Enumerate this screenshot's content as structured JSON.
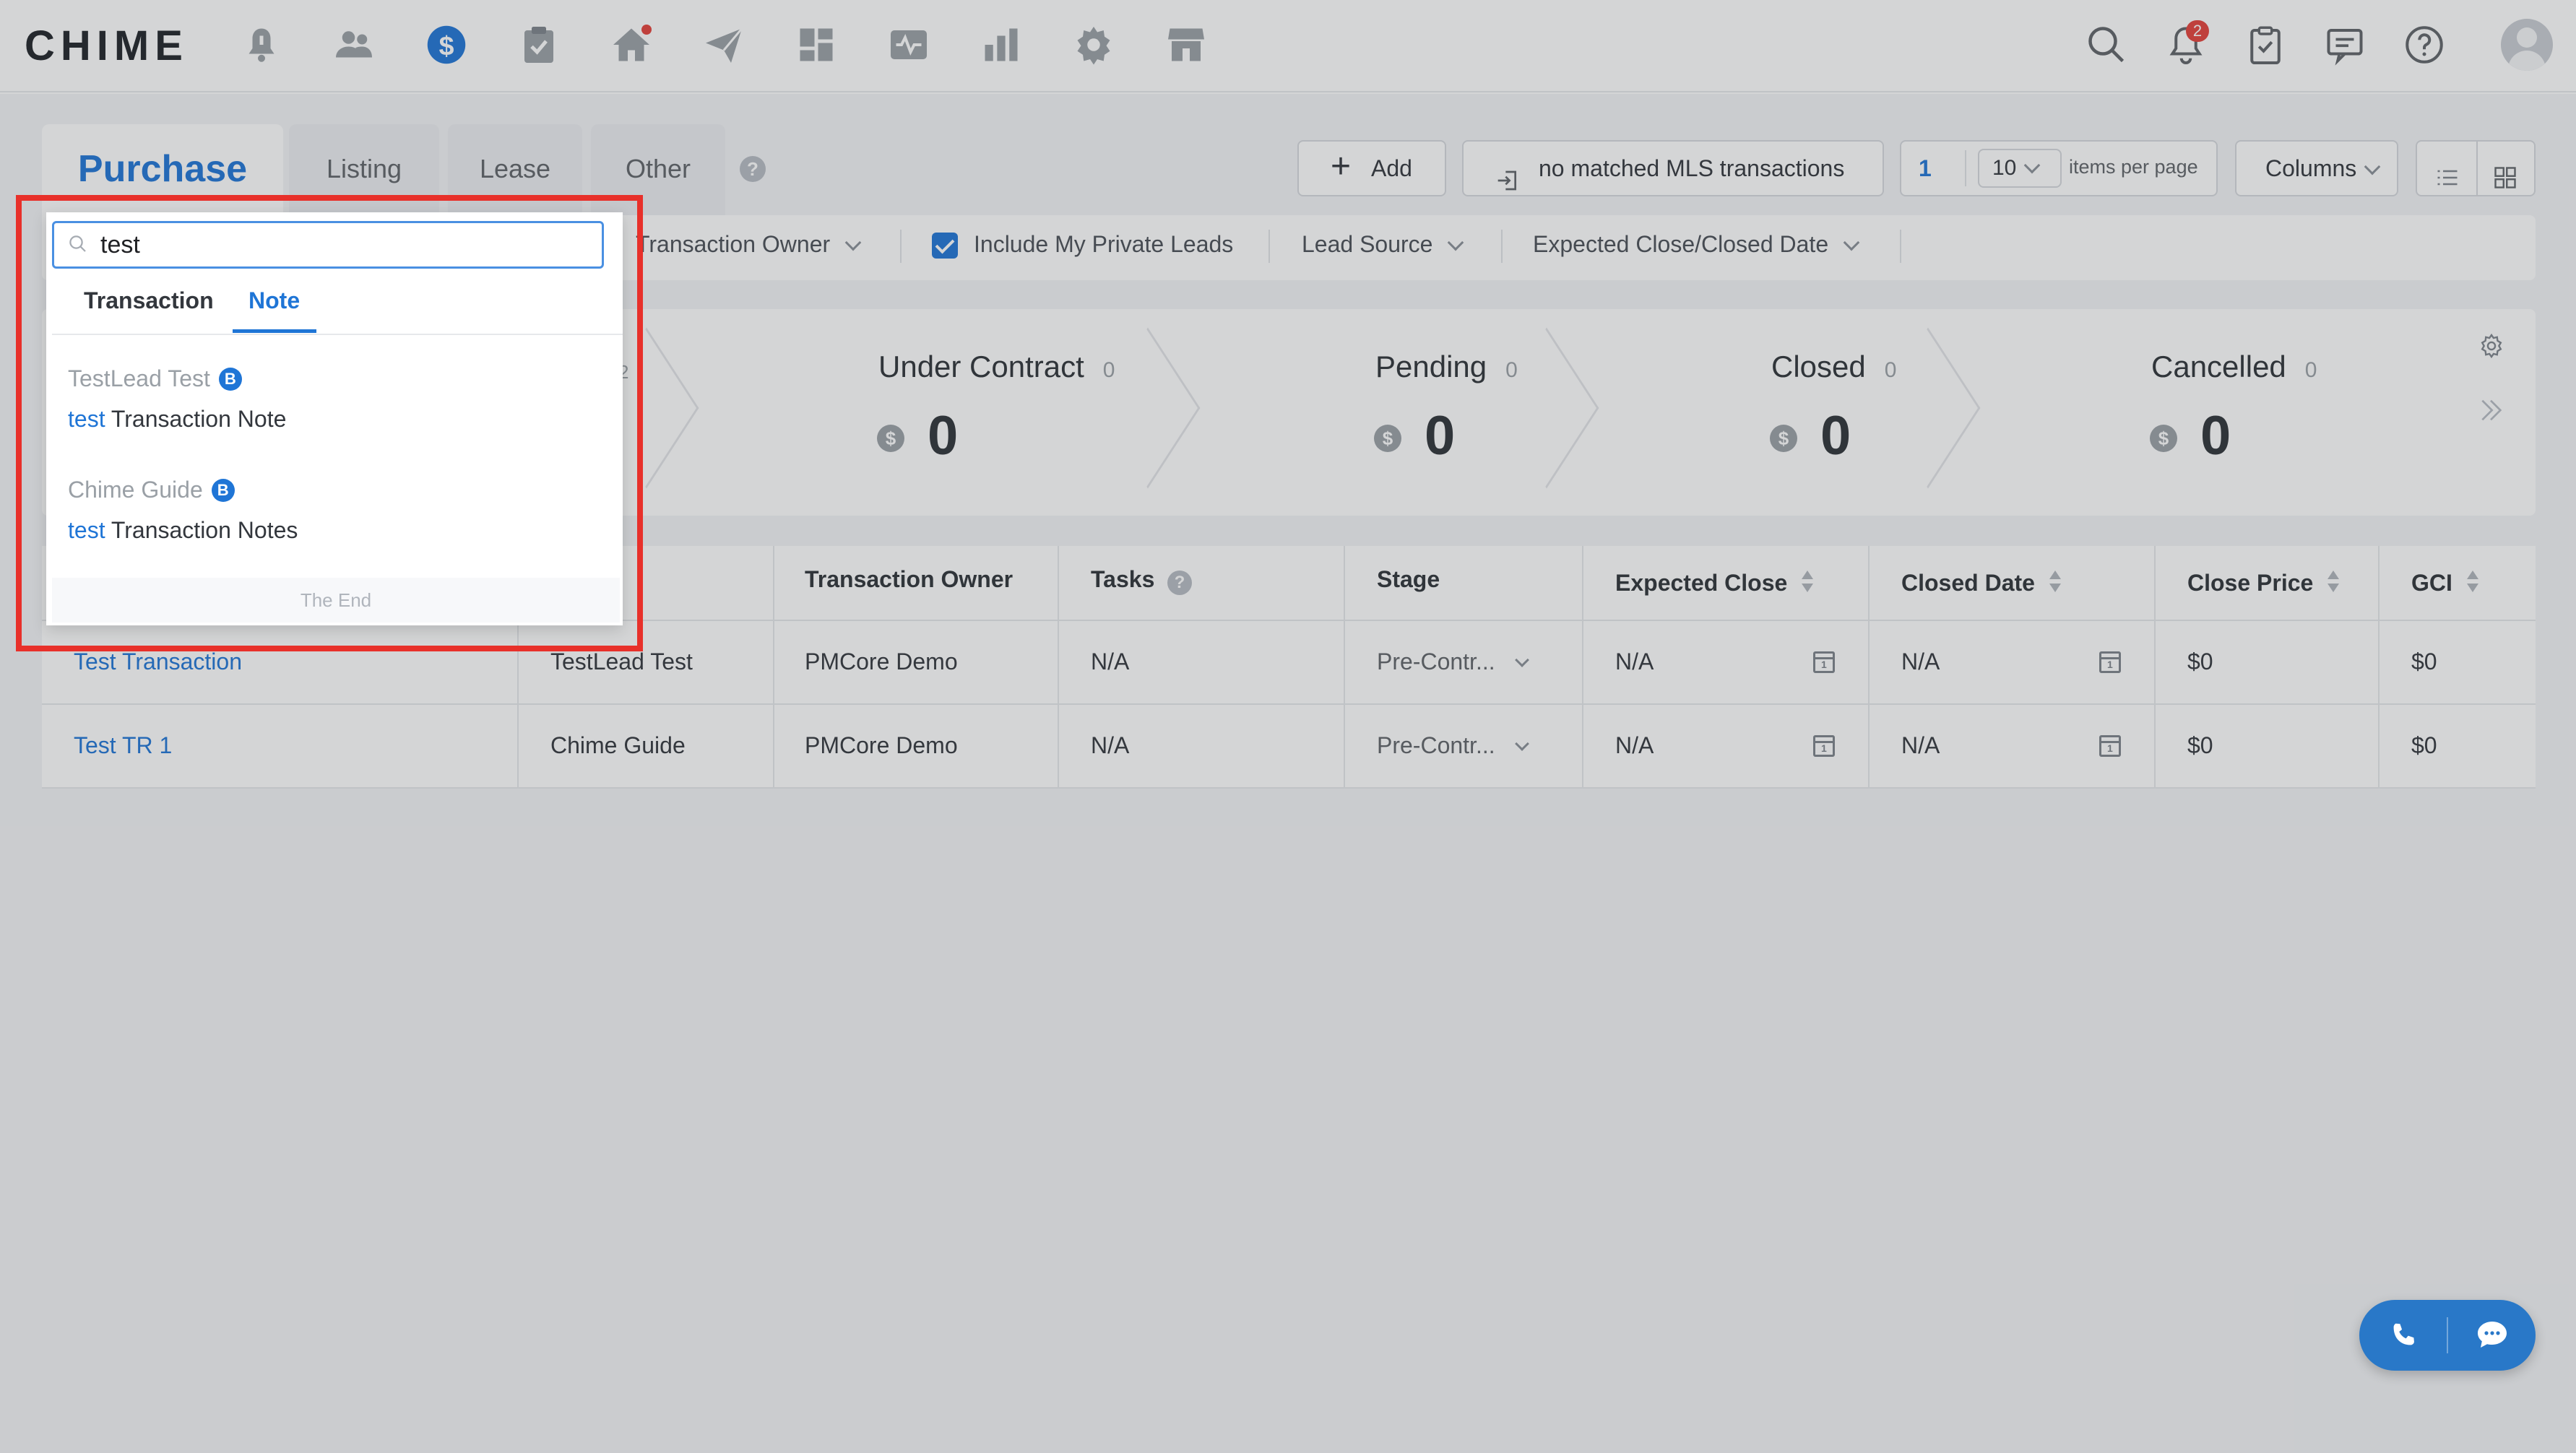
{
  "app": {
    "logo": "CHIME"
  },
  "topnav": {
    "icons": [
      {
        "name": "alert-icon"
      },
      {
        "name": "people-icon"
      },
      {
        "name": "dollar-icon",
        "active": true
      },
      {
        "name": "clipboard-icon"
      },
      {
        "name": "home-icon",
        "dot": true
      },
      {
        "name": "send-icon"
      },
      {
        "name": "grid-icon"
      },
      {
        "name": "activity-icon"
      },
      {
        "name": "bar-chart-icon"
      },
      {
        "name": "gear-icon"
      },
      {
        "name": "store-icon"
      }
    ],
    "notification_count": "2"
  },
  "tabs": {
    "purchase": "Purchase",
    "listing": "Listing",
    "lease": "Lease",
    "other": "Other",
    "help": "?"
  },
  "toolbar": {
    "add_label": "Add",
    "mls_label": "no matched MLS transactions",
    "page_number": "1",
    "page_size": "10",
    "items_per_page": "items per page",
    "columns_label": "Columns"
  },
  "filters": {
    "transaction_owner": "Transaction Owner",
    "include_private": "Include My Private Leads",
    "include_private_checked": true,
    "lead_source": "Lead Source",
    "date_filter": "Expected Close/Closed Date"
  },
  "pipeline": {
    "hidden_count": "2",
    "stages": [
      {
        "name": "Under Contract",
        "count": "0",
        "value": "0"
      },
      {
        "name": "Pending",
        "count": "0",
        "value": "0"
      },
      {
        "name": "Closed",
        "count": "0",
        "value": "0"
      },
      {
        "name": "Cancelled",
        "count": "0",
        "value": "0"
      }
    ],
    "coin_symbol": "$"
  },
  "table": {
    "headers": [
      "Transaction Owner",
      "Tasks",
      "Stage",
      "Expected Close",
      "Closed Date",
      "Close Price",
      "GCI"
    ],
    "tasks_help": "?",
    "rows": [
      {
        "name": "Test Transaction",
        "lead": "TestLead Test",
        "owner": "PMCore Demo",
        "tasks": "N/A",
        "stage": "Pre-Contr...",
        "expected_close": "N/A",
        "closed_date": "N/A",
        "close_price": "$0",
        "gci": "$0"
      },
      {
        "name": "Test TR 1",
        "lead": "Chime Guide",
        "owner": "PMCore Demo",
        "tasks": "N/A",
        "stage": "Pre-Contr...",
        "expected_close": "N/A",
        "closed_date": "N/A",
        "close_price": "$0",
        "gci": "$0"
      }
    ]
  },
  "search": {
    "query": "test",
    "tabs": [
      "Transaction",
      "Note"
    ],
    "active_tab": "Note",
    "results": [
      {
        "name": "TestLead Test",
        "badge": "B",
        "match": "test",
        "rest": " Transaction Note"
      },
      {
        "name": "Chime Guide",
        "badge": "B",
        "match": "test",
        "rest": " Transaction Notes"
      }
    ],
    "end_label": "The End"
  },
  "colors": {
    "accent": "#1f75d6",
    "highlight_border": "#e8302a",
    "badge_red": "#e5403a"
  }
}
